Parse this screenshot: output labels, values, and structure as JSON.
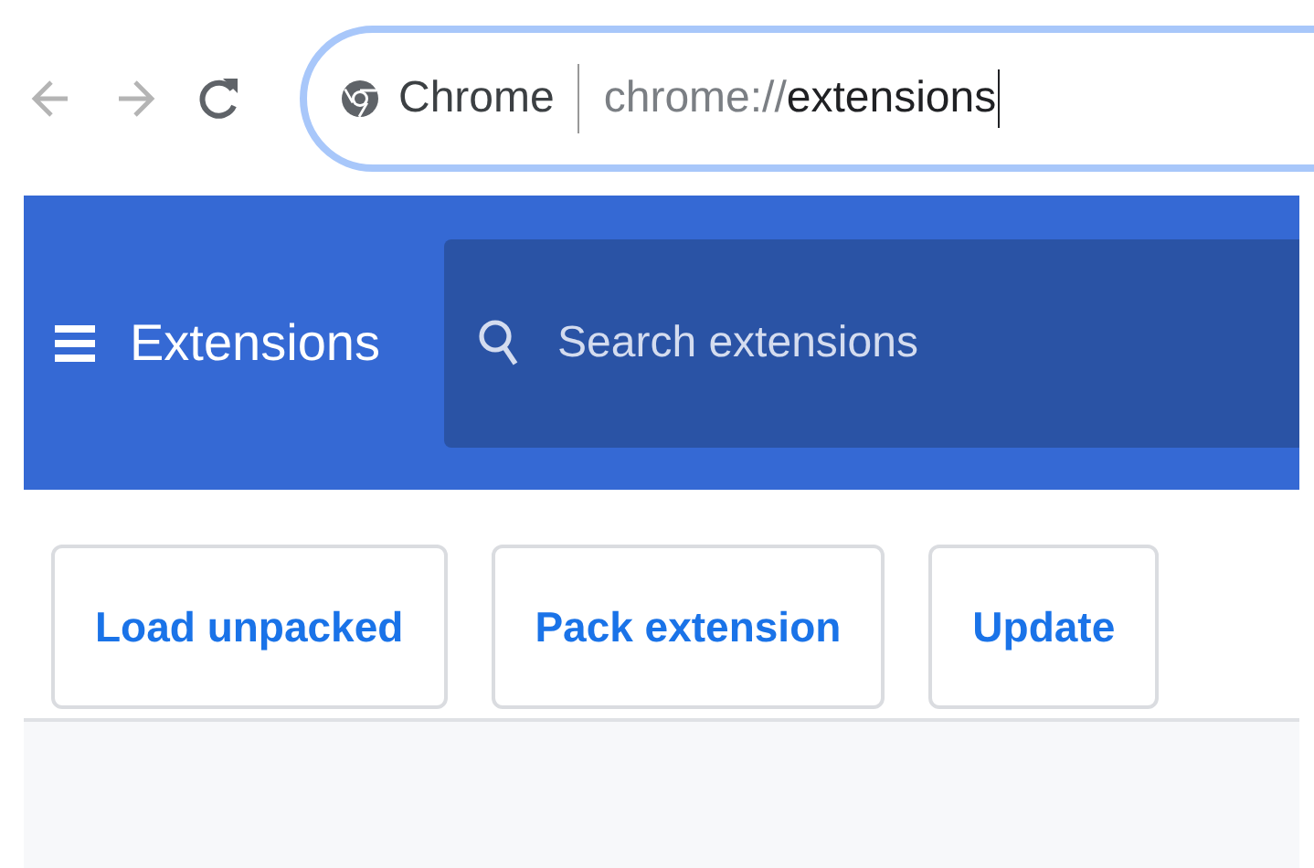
{
  "toolbar": {
    "nav": [
      {
        "kind": "back",
        "disabled": true
      },
      {
        "kind": "forward",
        "disabled": true
      },
      {
        "kind": "reload",
        "disabled": false
      }
    ],
    "omnibox": {
      "chip": "Chrome",
      "scheme": "chrome://",
      "path": "extensions",
      "focused": true
    }
  },
  "header": {
    "title": "Extensions",
    "search": {
      "placeholder": "Search extensions"
    }
  },
  "actions": [
    "Load unpacked",
    "Pack extension",
    "Update"
  ]
}
